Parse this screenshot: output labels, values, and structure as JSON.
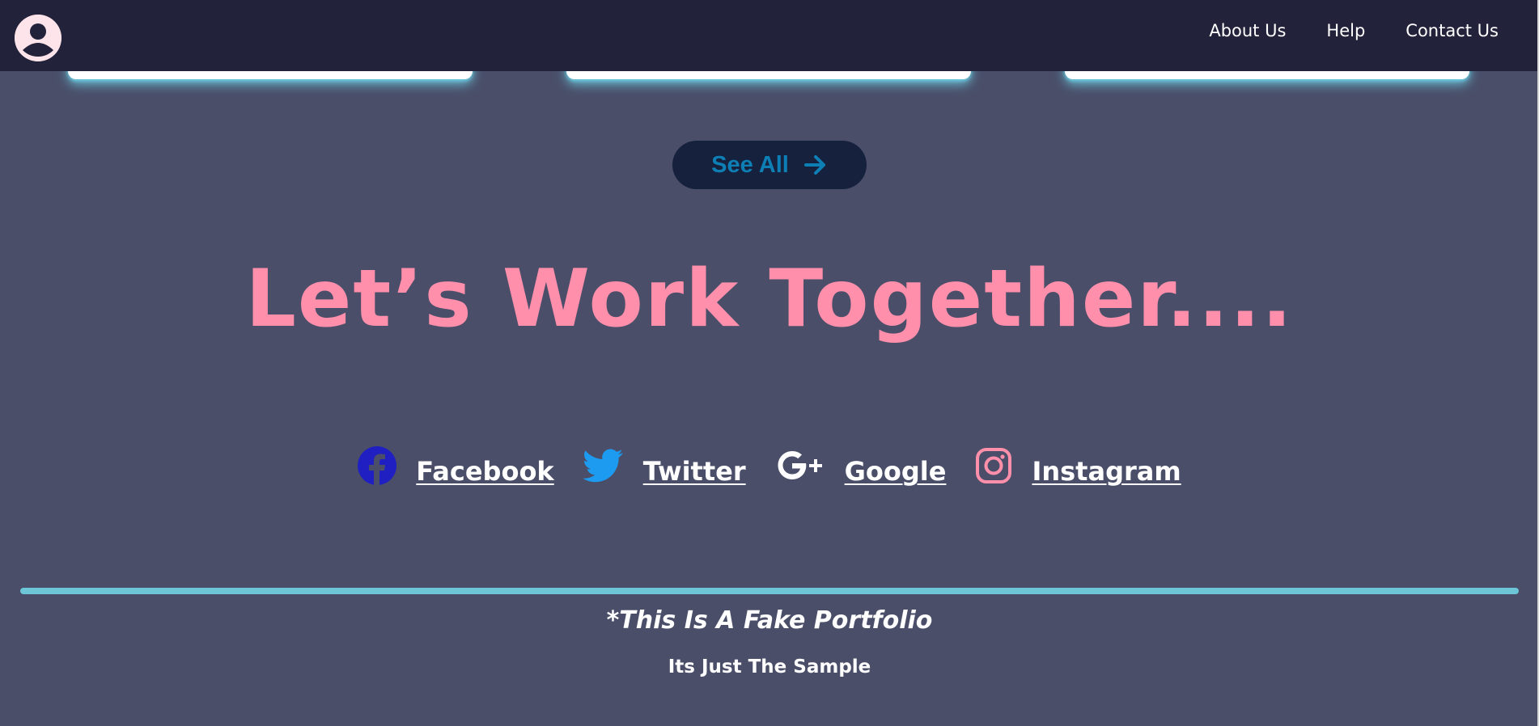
{
  "navbar": {
    "avatar_icon": "user-circle-icon",
    "links": [
      {
        "label": "About Us"
      },
      {
        "label": "Help"
      },
      {
        "label": "Contact Us"
      }
    ]
  },
  "see_all": {
    "label": "See All",
    "icon": "arrow-right-icon"
  },
  "headline": "Let’s Work Together....",
  "socials": [
    {
      "label": "Facebook",
      "icon": "facebook-icon",
      "color": "#1f1fc2"
    },
    {
      "label": "Twitter",
      "icon": "twitter-icon",
      "color": "#1d9bf0"
    },
    {
      "label": "Google",
      "icon": "google-plus-icon",
      "color": "#ffffff"
    },
    {
      "label": "Instagram",
      "icon": "instagram-icon",
      "color": "#ff8fab"
    }
  ],
  "footer": {
    "title": "*This Is A Fake Portfolio",
    "subtitle": "Its Just The Sample"
  },
  "colors": {
    "background": "#4a4e69",
    "navbar": "#22223b",
    "accent_pink": "#ff8fab",
    "divider": "#6cc6d8",
    "button_bg": "#16213e",
    "button_text": "#0e7fb5"
  }
}
